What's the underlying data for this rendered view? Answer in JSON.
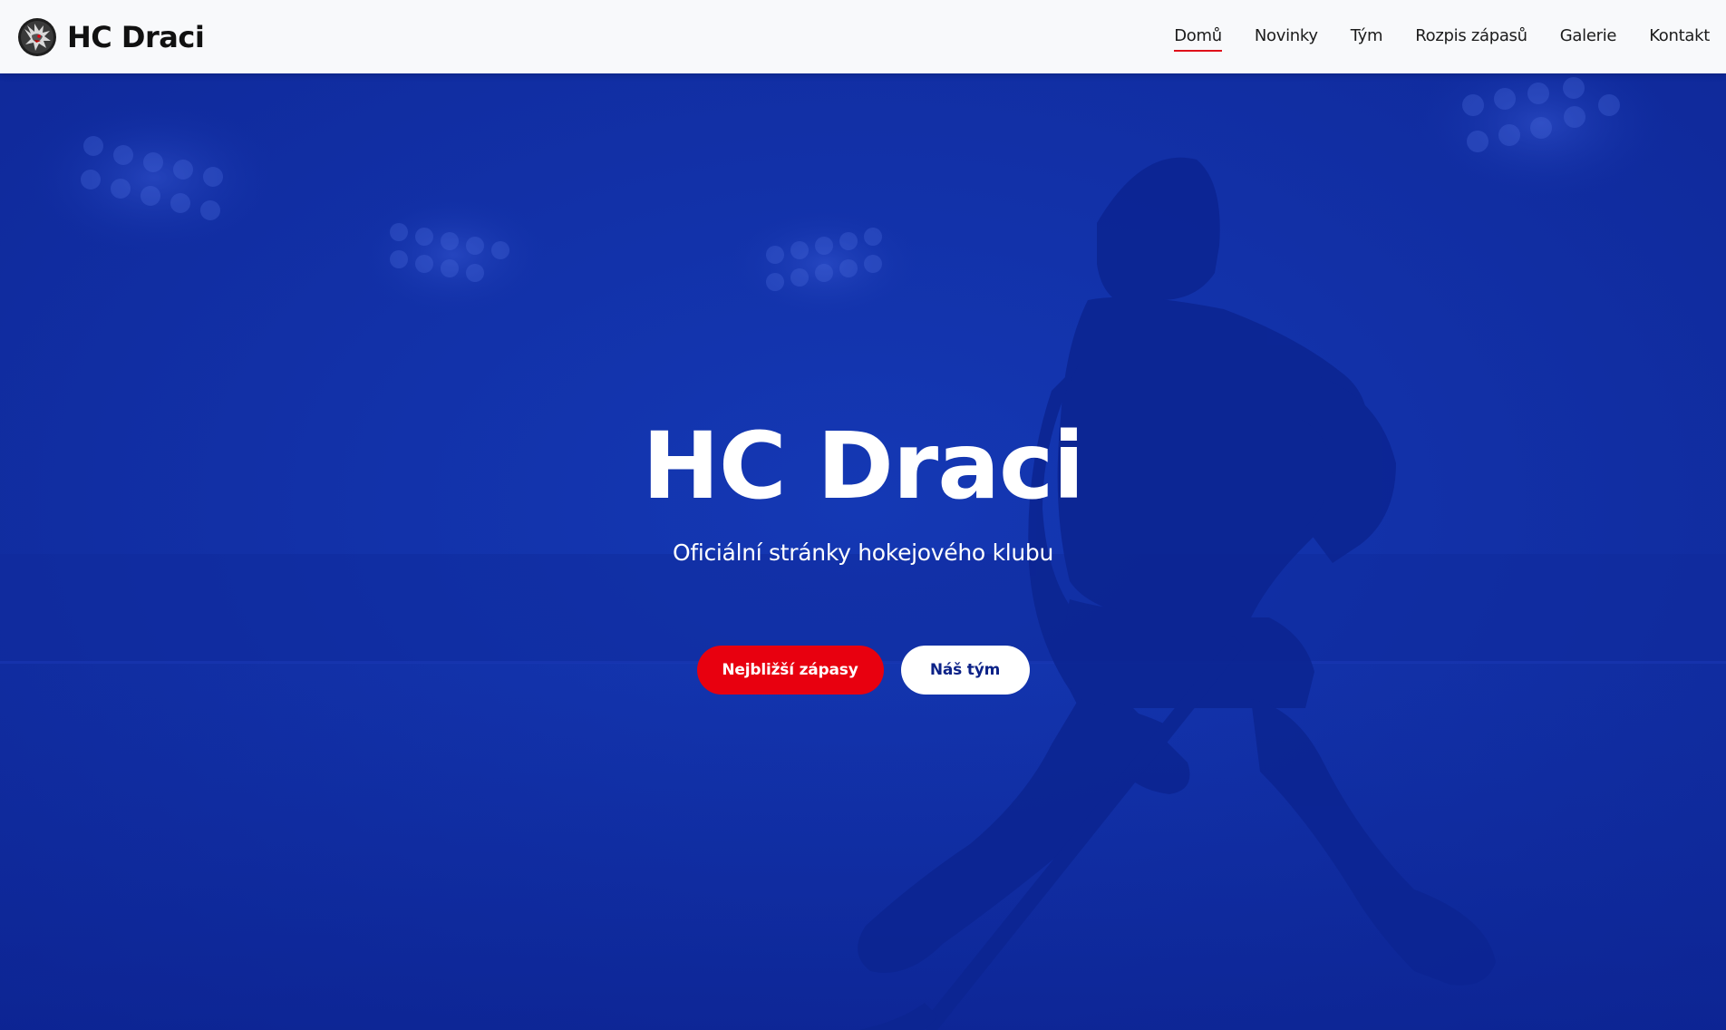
{
  "brand": {
    "name": "HC Draci",
    "logo_icon": "dragon-logo-icon"
  },
  "nav": {
    "items": [
      {
        "label": "Domů",
        "active": true
      },
      {
        "label": "Novinky",
        "active": false
      },
      {
        "label": "Tým",
        "active": false
      },
      {
        "label": "Rozpis zápasů",
        "active": false
      },
      {
        "label": "Galerie",
        "active": false
      },
      {
        "label": "Kontakt",
        "active": false
      }
    ]
  },
  "hero": {
    "title": "HC Draci",
    "subtitle": "Oficiální stránky hokejového klubu",
    "buttons": {
      "primary_label": "Nejbližší zápasy",
      "secondary_label": "Náš tým"
    },
    "background_image": "hockey-player-silhouette"
  },
  "colors": {
    "hero_blue": "#1231a8",
    "accent_red": "#e8000f",
    "navbar_bg": "#f8f9fb"
  }
}
